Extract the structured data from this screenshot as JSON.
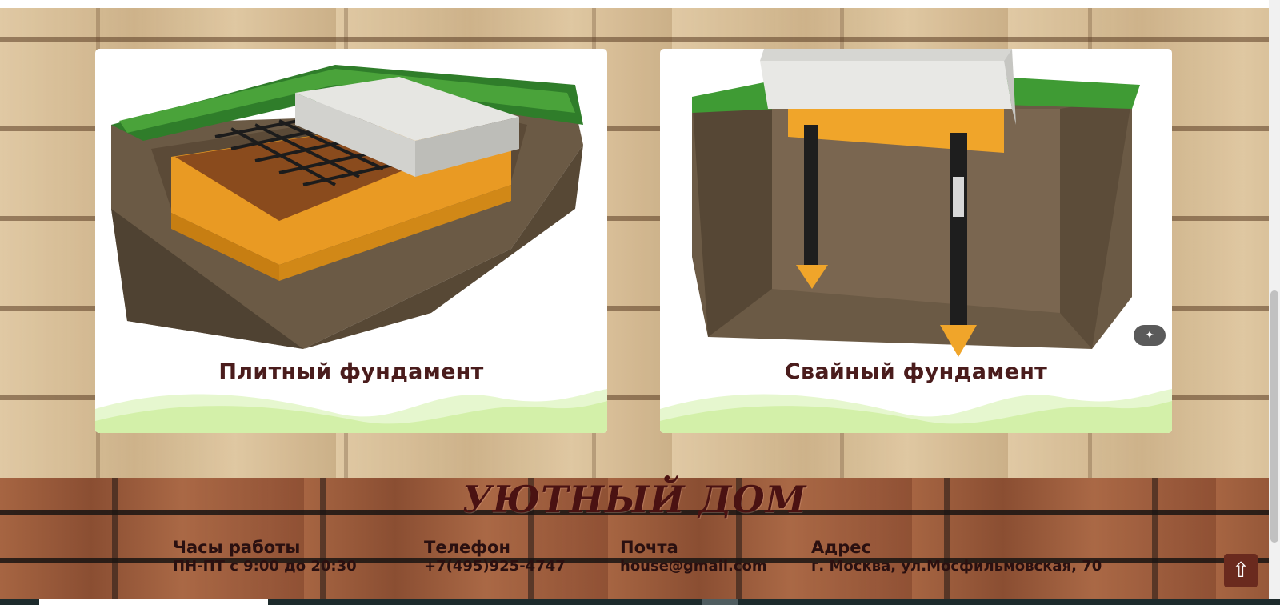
{
  "cards": [
    {
      "title": "Плитный фундамент",
      "image": "slab-foundation-illustration"
    },
    {
      "title": "Свайный фундамент",
      "image": "pile-foundation-illustration"
    }
  ],
  "footer": {
    "brand": "УЮТНЫЙ ДОМ",
    "hours": {
      "label": "Часы работы",
      "value": "ПН-ПТ с 9:00 до 20:30"
    },
    "phone": {
      "label": "Телефон",
      "value": "+7(495)925-4747"
    },
    "mail": {
      "label": "Почта",
      "value": "house@gmail.com"
    },
    "address": {
      "label": "Адрес",
      "value": "г. Москва, ул.Мосфильмовская, 70"
    }
  },
  "colors": {
    "title": "#4a1c1c",
    "brand": "#4a1212",
    "footer_text": "#2a1010",
    "up_button": "#6a2a1e"
  },
  "icons": {
    "scroll_top": "arrow-up-icon",
    "image_tools": "magic-wand-icon"
  }
}
